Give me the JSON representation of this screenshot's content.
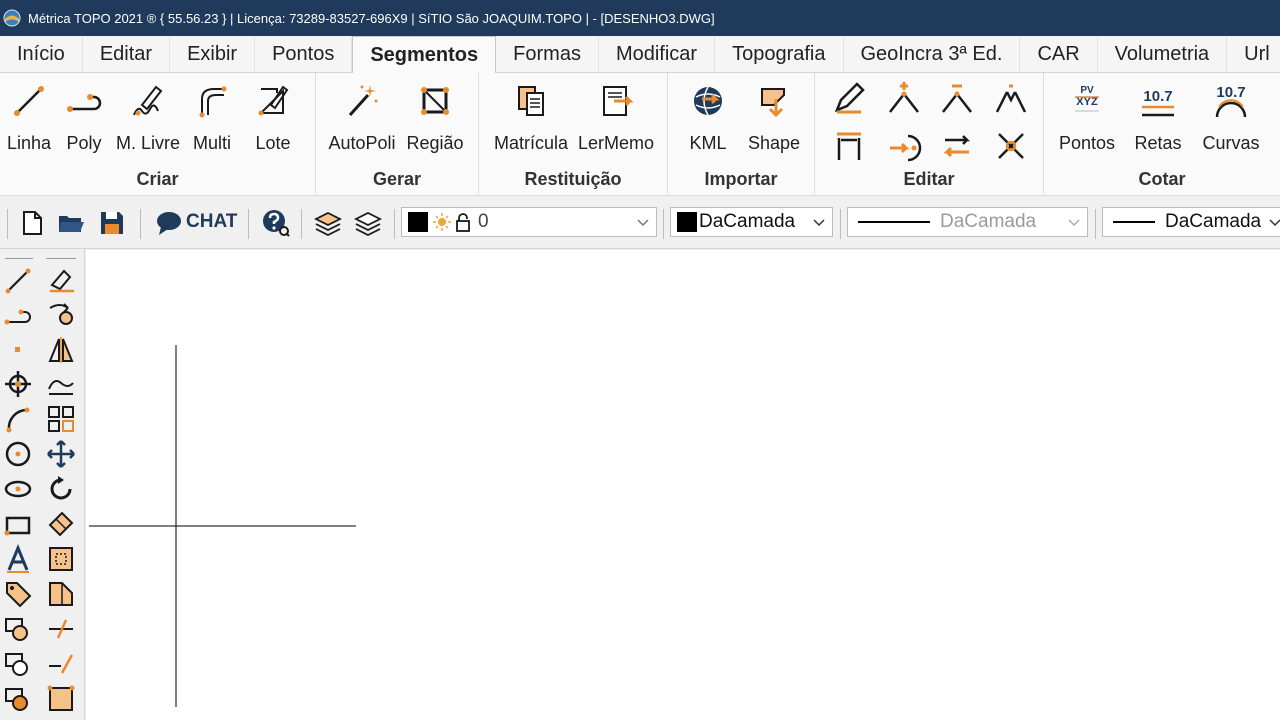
{
  "window": {
    "title": "Métrica TOPO 2021 ® { 55.56.23 } | Licença: 73289-83527-696X9 | SíTIO São JOAQUIM.TOPO |  - [DESENHO3.DWG]"
  },
  "menu": {
    "tabs": [
      "Início",
      "Editar",
      "Exibir",
      "Pontos",
      "Segmentos",
      "Formas",
      "Modificar",
      "Topografia",
      "GeoIncra 3ª Ed.",
      "CAR",
      "Volumetria",
      "Url"
    ],
    "active": "Segmentos"
  },
  "ribbon": {
    "groups": {
      "criar": {
        "label": "Criar",
        "buttons": [
          "Linha",
          "Poly",
          "M. Livre",
          "Multi",
          "Lote"
        ]
      },
      "gerar": {
        "label": "Gerar",
        "buttons": [
          "AutoPoli",
          "Região"
        ]
      },
      "restituicao": {
        "label": "Restituição",
        "buttons": [
          "Matrícula",
          "LerMemo"
        ]
      },
      "importar": {
        "label": "Importar",
        "buttons": [
          "KML",
          "Shape"
        ]
      },
      "editar": {
        "label": "Editar"
      },
      "cotar": {
        "label": "Cotar",
        "buttons": [
          "Pontos",
          "Retas",
          "Curvas"
        ],
        "icon_texts": {
          "pontos_top": "PV",
          "pontos_mid": "XYZ",
          "retas": "10.7",
          "curvas": "10.7"
        }
      }
    }
  },
  "toolbar": {
    "chat_label": "CHAT",
    "layer_value": "0",
    "color_value": "DaCamada",
    "linetype_value": "DaCamada",
    "lineweight_value": "DaCamada"
  },
  "colors": {
    "titlebar": "#1f3a5a",
    "accent_orange": "#e88a2e",
    "icon_dark": "#1a1a1a",
    "icon_navy": "#1f3a5a"
  }
}
